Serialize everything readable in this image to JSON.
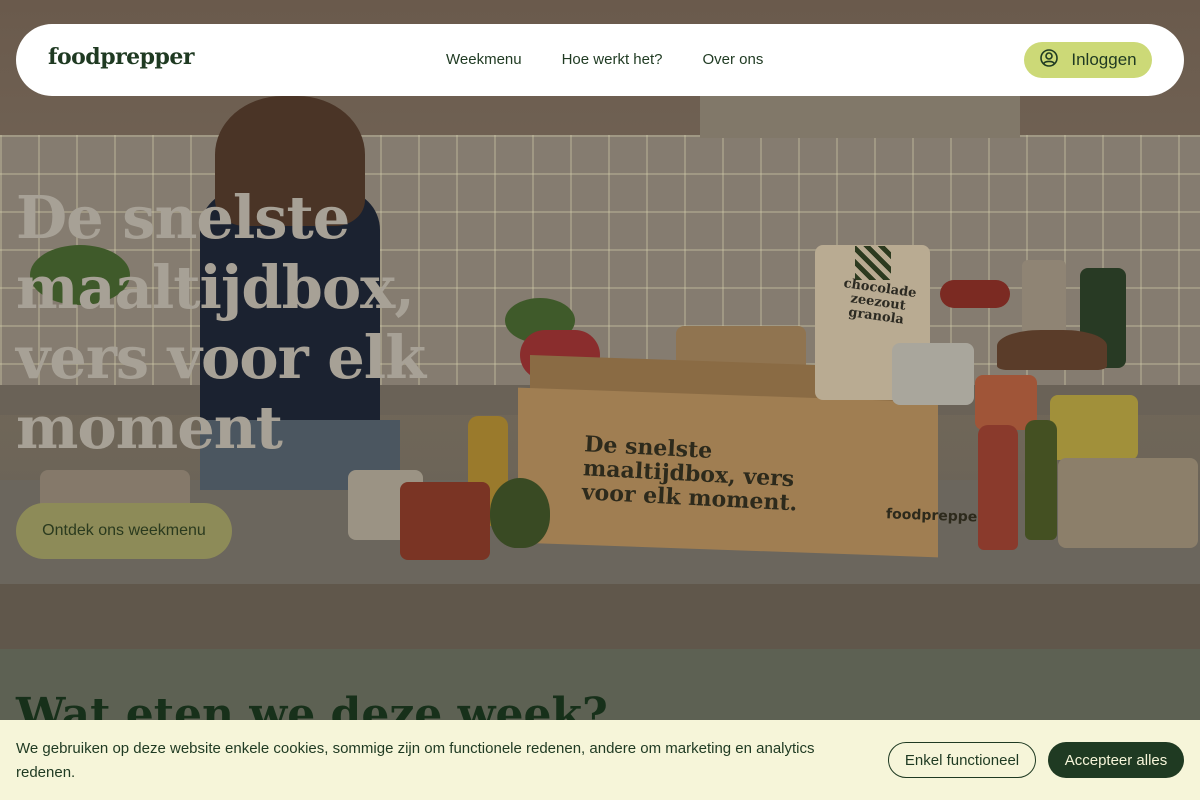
{
  "nav": {
    "logo": "foodprepper",
    "links": [
      "Weekmenu",
      "Hoe werkt het?",
      "Over ons"
    ],
    "login_label": "Inloggen",
    "login_icon": "user-circle-icon"
  },
  "hero": {
    "title": "De snelste maaltijdbox, vers voor elk moment",
    "cta_label": "Ontdek ons weekmenu",
    "box_print": "De snelste maaltijdbox, vers voor elk moment.",
    "box_brand": "foodprepper",
    "granola_label": "chocolade zeezout granola"
  },
  "section": {
    "title": "Wat eten we deze week?"
  },
  "cookies": {
    "text": "We gebruiken op deze website enkele cookies, sommige zijn om functionele redenen, andere om marketing en analytics redenen.",
    "functional_label": "Enkel functioneel",
    "accept_label": "Accepteer alles"
  },
  "colors": {
    "brand_dark": "#1f3a22",
    "accent_lime": "#ccd977",
    "cookie_bg": "#f6f5d9"
  }
}
